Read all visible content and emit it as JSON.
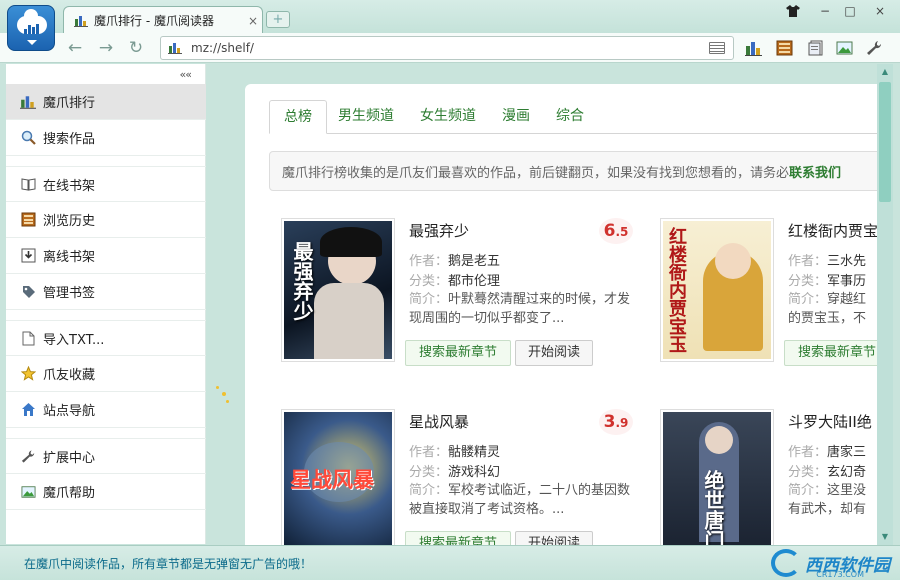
{
  "window": {
    "tab_title": "魔爪排行 - 魔爪阅读器",
    "tab_close": "×",
    "new_tab": "+",
    "controls": [
      "−",
      "□",
      "×"
    ]
  },
  "toolbar": {
    "back": "←",
    "forward": "→",
    "refresh": "↻",
    "address": "mz://shelf/"
  },
  "sidebar": {
    "collapse": "««",
    "items": [
      {
        "label": "魔爪排行",
        "icon": "ranking-chart-icon"
      },
      {
        "label": "搜索作品",
        "icon": "search-icon"
      },
      {
        "label": "在线书架",
        "icon": "book-icon"
      },
      {
        "label": "浏览历史",
        "icon": "history-icon"
      },
      {
        "label": "离线书架",
        "icon": "download-icon"
      },
      {
        "label": "管理书签",
        "icon": "bookmark-icon"
      },
      {
        "label": "导入TXT...",
        "icon": "file-icon"
      },
      {
        "label": "爪友收藏",
        "icon": "star-icon"
      },
      {
        "label": "站点导航",
        "icon": "home-icon"
      },
      {
        "label": "扩展中心",
        "icon": "wrench-icon"
      },
      {
        "label": "魔爪帮助",
        "icon": "help-image-icon"
      }
    ]
  },
  "main": {
    "tabs": [
      "总榜",
      "男生频道",
      "女生频道",
      "漫画",
      "综合"
    ],
    "notice_text": "魔爪排行榜收集的是爪友们最喜欢的作品，前后键翻页，如果没有找到您想看的，请务必",
    "notice_link": "联系我们",
    "author_key": "作者：",
    "category_key": "分类：",
    "intro_key": "简介：",
    "search_button": "搜索最新章节",
    "read_button": "开始阅读",
    "books": [
      {
        "title": "最强弃少",
        "score_int": "6",
        "score_dec": ".5",
        "author": "鹅是老五",
        "category": "都市伦理",
        "intro": "叶默蓦然清醒过来的时候，才发现周围的一切似乎都变了...",
        "cover_text": "最强弃少",
        "cover_color": "#1b2a3c"
      },
      {
        "title": "红楼衙内贾宝",
        "score_int": "",
        "score_dec": "",
        "author": "三水先",
        "category": "军事历",
        "intro": "穿越红",
        "intro2": "的贾宝玉，不",
        "cover_text": "红楼衙内贾宝玉",
        "cover_color": "#f4e9c6"
      },
      {
        "title": "星战风暴",
        "score_int": "3",
        "score_dec": ".9",
        "author": "骷髅精灵",
        "category": "游戏科幻",
        "intro": "军校考试临近，二十八的基因数被直接取消了考试资格。...",
        "cover_text": "星战风暴",
        "cover_color": "#14304d"
      },
      {
        "title": "斗罗大陆II绝",
        "score_int": "",
        "score_dec": "",
        "author": "唐家三",
        "category": "玄幻奇",
        "intro": "这里没",
        "intro2": "有武术，却有",
        "cover_text": "绝世唐门",
        "cover_color": "#2c3440"
      }
    ]
  },
  "status": {
    "text": "在魔爪中阅读作品，所有章节都是无弹窗无广告的哦！",
    "watermark": "西西软件园",
    "watermark_sub": "CR173.COM"
  },
  "colors": {
    "accent_green": "#2e7d32",
    "score_red": "#d0312d",
    "chrome_bg": "#c9e4dc"
  }
}
